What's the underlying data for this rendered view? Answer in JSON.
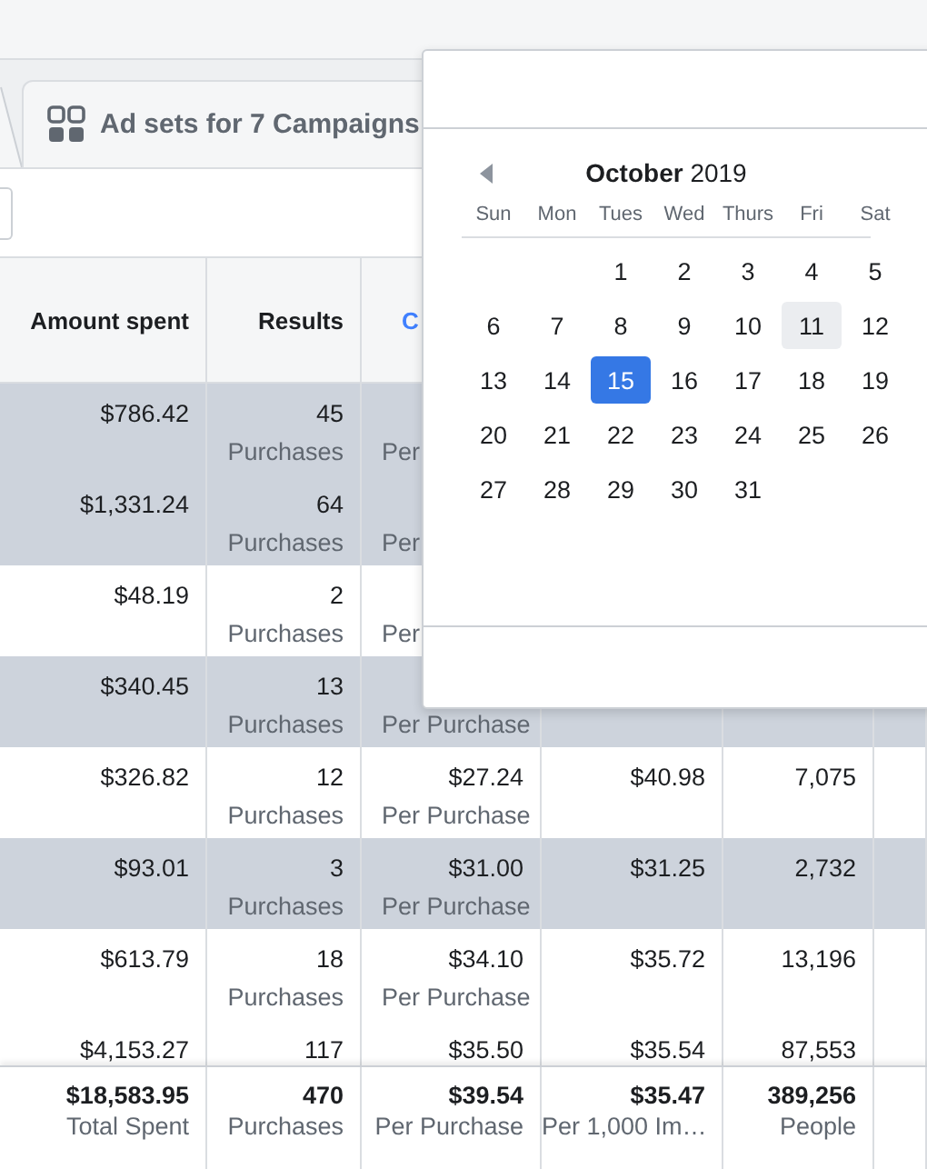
{
  "tab": {
    "label": "Ad sets for 7 Campaigns"
  },
  "table": {
    "columns": [
      {
        "label": "Amount spent",
        "kind": "text"
      },
      {
        "label": "Results",
        "kind": "text"
      },
      {
        "label": "C",
        "kind": "link"
      }
    ],
    "rows": [
      {
        "selected": true,
        "cells": [
          {
            "value": "$786.42"
          },
          {
            "value": "45",
            "sub": "Purchases"
          },
          {
            "sub": "Per"
          }
        ]
      },
      {
        "selected": true,
        "cells": [
          {
            "value": "$1,331.24"
          },
          {
            "value": "64",
            "sub": "Purchases"
          },
          {
            "sub": "Per"
          }
        ]
      },
      {
        "selected": false,
        "cells": [
          {
            "value": "$48.19"
          },
          {
            "value": "2",
            "sub": "Purchases"
          },
          {
            "sub": "Per"
          }
        ]
      },
      {
        "selected": true,
        "cells": [
          {
            "value": "$340.45"
          },
          {
            "value": "13",
            "sub": "Purchases"
          },
          {
            "sub": "Per Purchase"
          }
        ]
      },
      {
        "selected": false,
        "cells": [
          {
            "value": "$326.82"
          },
          {
            "value": "12",
            "sub": "Purchases"
          },
          {
            "value": "$27.24",
            "sub": "Per Purchase"
          },
          {
            "value": "$40.98"
          },
          {
            "value": "7,075"
          }
        ]
      },
      {
        "selected": true,
        "cells": [
          {
            "value": "$93.01"
          },
          {
            "value": "3",
            "sub": "Purchases"
          },
          {
            "value": "$31.00",
            "sub": "Per Purchase"
          },
          {
            "value": "$31.25"
          },
          {
            "value": "2,732"
          }
        ]
      },
      {
        "selected": false,
        "cells": [
          {
            "value": "$613.79"
          },
          {
            "value": "18",
            "sub": "Purchases"
          },
          {
            "value": "$34.10",
            "sub": "Per Purchase"
          },
          {
            "value": "$35.72"
          },
          {
            "value": "13,196"
          }
        ]
      },
      {
        "selected": false,
        "cells": [
          {
            "value": "$4,153.27"
          },
          {
            "value": "117"
          },
          {
            "value": "$35.50"
          },
          {
            "value": "$35.54"
          },
          {
            "value": "87,553"
          }
        ]
      }
    ],
    "totals": [
      {
        "value": "$18,583.95",
        "sub": "Total Spent"
      },
      {
        "value": "470",
        "sub": "Purchases"
      },
      {
        "value": "$39.54",
        "sub": "Per Purchase"
      },
      {
        "value": "$35.47",
        "sub": "Per 1,000 Im…"
      },
      {
        "value": "389,256",
        "sub": "People"
      }
    ]
  },
  "calendar": {
    "title": "**October** 2019",
    "weekdays": [
      "Sun",
      "Mon",
      "Tues",
      "Wed",
      "Thurs",
      "Fri",
      "Sat"
    ],
    "weeks": [
      [
        {
          "day": "1",
          "selected": false,
          "highlighted": false
        },
        {
          "day": "2",
          "selected": false,
          "highlighted": false
        },
        {
          "day": "3",
          "selected": false,
          "highlighted": false
        },
        {
          "day": "4",
          "selected": false,
          "highlighted": false
        },
        {
          "day": "5",
          "selected": false,
          "highlighted": false
        }
      ],
      [
        {
          "day": "6",
          "selected": false,
          "highlighted": false
        },
        {
          "day": "7",
          "selected": false,
          "highlighted": false
        },
        {
          "day": "8",
          "selected": false,
          "highlighted": false
        },
        {
          "day": "9",
          "selected": false,
          "highlighted": false
        },
        {
          "day": "10",
          "selected": false,
          "highlighted": false
        },
        {
          "day": "11",
          "selected": false,
          "highlighted": true
        },
        {
          "day": "12",
          "selected": false,
          "highlighted": false
        }
      ],
      [
        {
          "day": "13",
          "selected": false,
          "highlighted": false
        },
        {
          "day": "14",
          "selected": false,
          "highlighted": false
        },
        {
          "day": "15",
          "selected": true,
          "highlighted": false
        },
        {
          "day": "16",
          "selected": false,
          "highlighted": false
        },
        {
          "day": "17",
          "selected": false,
          "highlighted": false
        },
        {
          "day": "18",
          "selected": false,
          "highlighted": false
        },
        {
          "day": "19",
          "selected": false,
          "highlighted": false
        }
      ],
      [
        {
          "day": "20",
          "selected": false,
          "highlighted": false
        },
        {
          "day": "21",
          "selected": false,
          "highlighted": false
        },
        {
          "day": "22",
          "selected": false,
          "highlighted": false
        },
        {
          "day": "23",
          "selected": false,
          "highlighted": false
        },
        {
          "day": "24",
          "selected": false,
          "highlighted": false
        },
        {
          "day": "25",
          "selected": false,
          "highlighted": false
        },
        {
          "day": "26",
          "selected": false,
          "highlighted": false
        }
      ],
      [
        {
          "day": "27",
          "selected": false,
          "highlighted": false
        },
        {
          "day": "28",
          "selected": false,
          "highlighted": false
        },
        {
          "day": "29",
          "selected": false,
          "highlighted": false
        },
        {
          "day": "30",
          "selected": false,
          "highlighted": false
        },
        {
          "day": "31",
          "selected": false,
          "highlighted": false
        }
      ]
    ]
  }
}
